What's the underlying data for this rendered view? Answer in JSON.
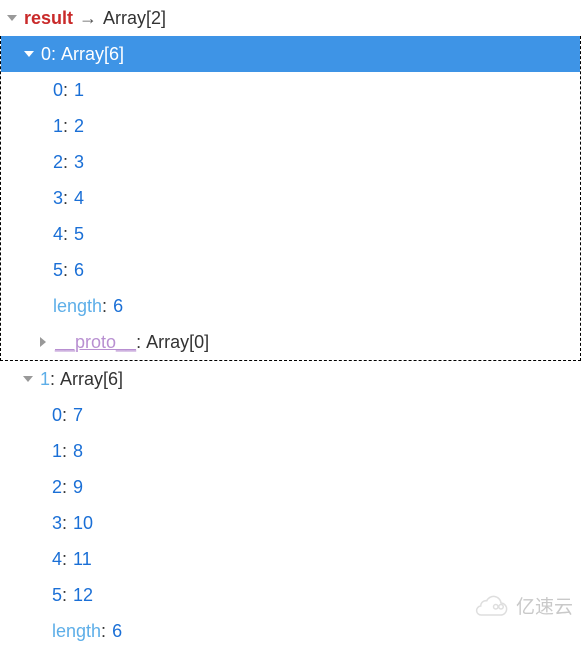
{
  "root": {
    "name": "result",
    "sep": "→",
    "type": "Array[2]"
  },
  "items": [
    {
      "index": "0",
      "type": "Array[6]",
      "selected": true,
      "entries": [
        {
          "k": "0",
          "v": "1"
        },
        {
          "k": "1",
          "v": "2"
        },
        {
          "k": "2",
          "v": "3"
        },
        {
          "k": "3",
          "v": "4"
        },
        {
          "k": "4",
          "v": "5"
        },
        {
          "k": "5",
          "v": "6"
        }
      ],
      "length_key": "length",
      "length": "6",
      "proto_key": "__proto__",
      "proto_type": "Array[0]"
    },
    {
      "index": "1",
      "type": "Array[6]",
      "selected": false,
      "entries": [
        {
          "k": "0",
          "v": "7"
        },
        {
          "k": "1",
          "v": "8"
        },
        {
          "k": "2",
          "v": "9"
        },
        {
          "k": "3",
          "v": "10"
        },
        {
          "k": "4",
          "v": "11"
        },
        {
          "k": "5",
          "v": "12"
        }
      ],
      "length_key": "length",
      "length": "6"
    }
  ],
  "watermark": "亿速云"
}
